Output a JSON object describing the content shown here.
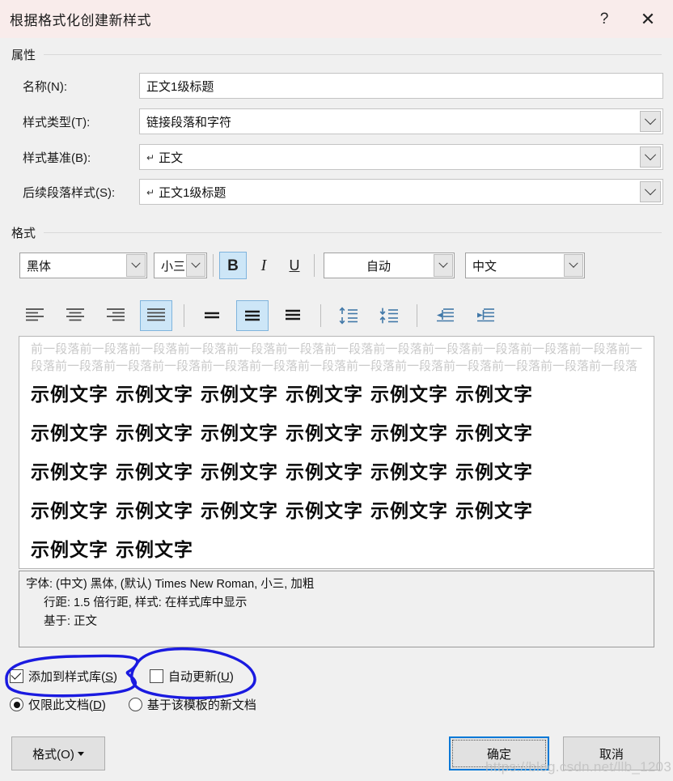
{
  "window": {
    "title": "根据格式化创建新样式",
    "help_label": "?",
    "close_label": "✕"
  },
  "properties": {
    "group_label": "属性",
    "fields": [
      {
        "label": "名称(N):",
        "value": "正文1级标题",
        "prefix": "",
        "dropdown": false,
        "underline": false
      },
      {
        "label": "样式类型(T):",
        "value": "链接段落和字符",
        "prefix": "",
        "dropdown": true,
        "underline": false
      },
      {
        "label": "样式基准(B):",
        "value": "正文",
        "prefix": "↵",
        "dropdown": true,
        "underline": true
      },
      {
        "label": "后续段落样式(S):",
        "value": "正文1级标题",
        "prefix": "↵",
        "dropdown": true,
        "underline": true
      }
    ]
  },
  "format": {
    "group_label": "格式",
    "font_name": "黑体",
    "font_size": "小三",
    "bold_label": "B",
    "italic_label": "I",
    "underline_label": "U",
    "font_color": "自动",
    "language": "中文",
    "active_bold": true,
    "active_align": "justify",
    "active_linespacing": "1.5",
    "accent_active": "#cde6f7",
    "icon_blue": "#4178a8",
    "align_icons": [
      "align-left-icon",
      "align-center-icon",
      "align-right-icon",
      "align-justify-icon"
    ],
    "spacing_icons": [
      "line-spacing-single-icon",
      "line-spacing-1-5-icon",
      "line-spacing-double-icon"
    ],
    "para_icons": [
      "increase-paragraph-spacing-icon",
      "decrease-paragraph-spacing-icon"
    ],
    "indent_icons": [
      "decrease-indent-icon",
      "increase-indent-icon"
    ]
  },
  "preview": {
    "filler_text": "前一段落前一段落前一段落前一段落前一段落前一段落前一段落前一段落前一段落前一段落前一段落前一段落前一段落前一段落前一段落前一段落前一段落前一段落前一段落前一段落前一段落前一段落前一段落前一段落前一段落",
    "sample_full_row": "示例文字  示例文字  示例文字  示例文字  示例文字  示例文字",
    "sample_partial_row": "示例文字  示例文字",
    "full_rows": 4
  },
  "description": {
    "line1": "字体: (中文) 黑体, (默认) Times New Roman, 小三, 加粗",
    "line2": "行距: 1.5 倍行距, 样式: 在样式库中显示",
    "line3": "基于: 正文"
  },
  "options": {
    "checkbox_add_to_gallery": {
      "label_pre": "添加到样式库(",
      "label_key": "S",
      "label_post": ")",
      "checked": true
    },
    "checkbox_auto_update": {
      "label_pre": "自动更新(",
      "label_key": "U",
      "label_post": ")",
      "checked": false
    },
    "radio_this_document": {
      "label_pre": "仅限此文档(",
      "label_key": "D",
      "label_post": ")",
      "selected": true
    },
    "radio_new_documents": {
      "label_pre": "基于该模板的新文档",
      "label_key": "",
      "label_post": "",
      "selected": false
    }
  },
  "footer": {
    "format_button": "格式(O)",
    "ok_button": "确定",
    "cancel_button": "取消"
  },
  "watermark": {
    "text": "https://blog.csdn.net/llb_1203"
  },
  "annotations": {
    "color": "#1a1ae0",
    "shapes": [
      "ellipse-around-add-to-gallery",
      "ellipse-around-auto-update"
    ]
  }
}
